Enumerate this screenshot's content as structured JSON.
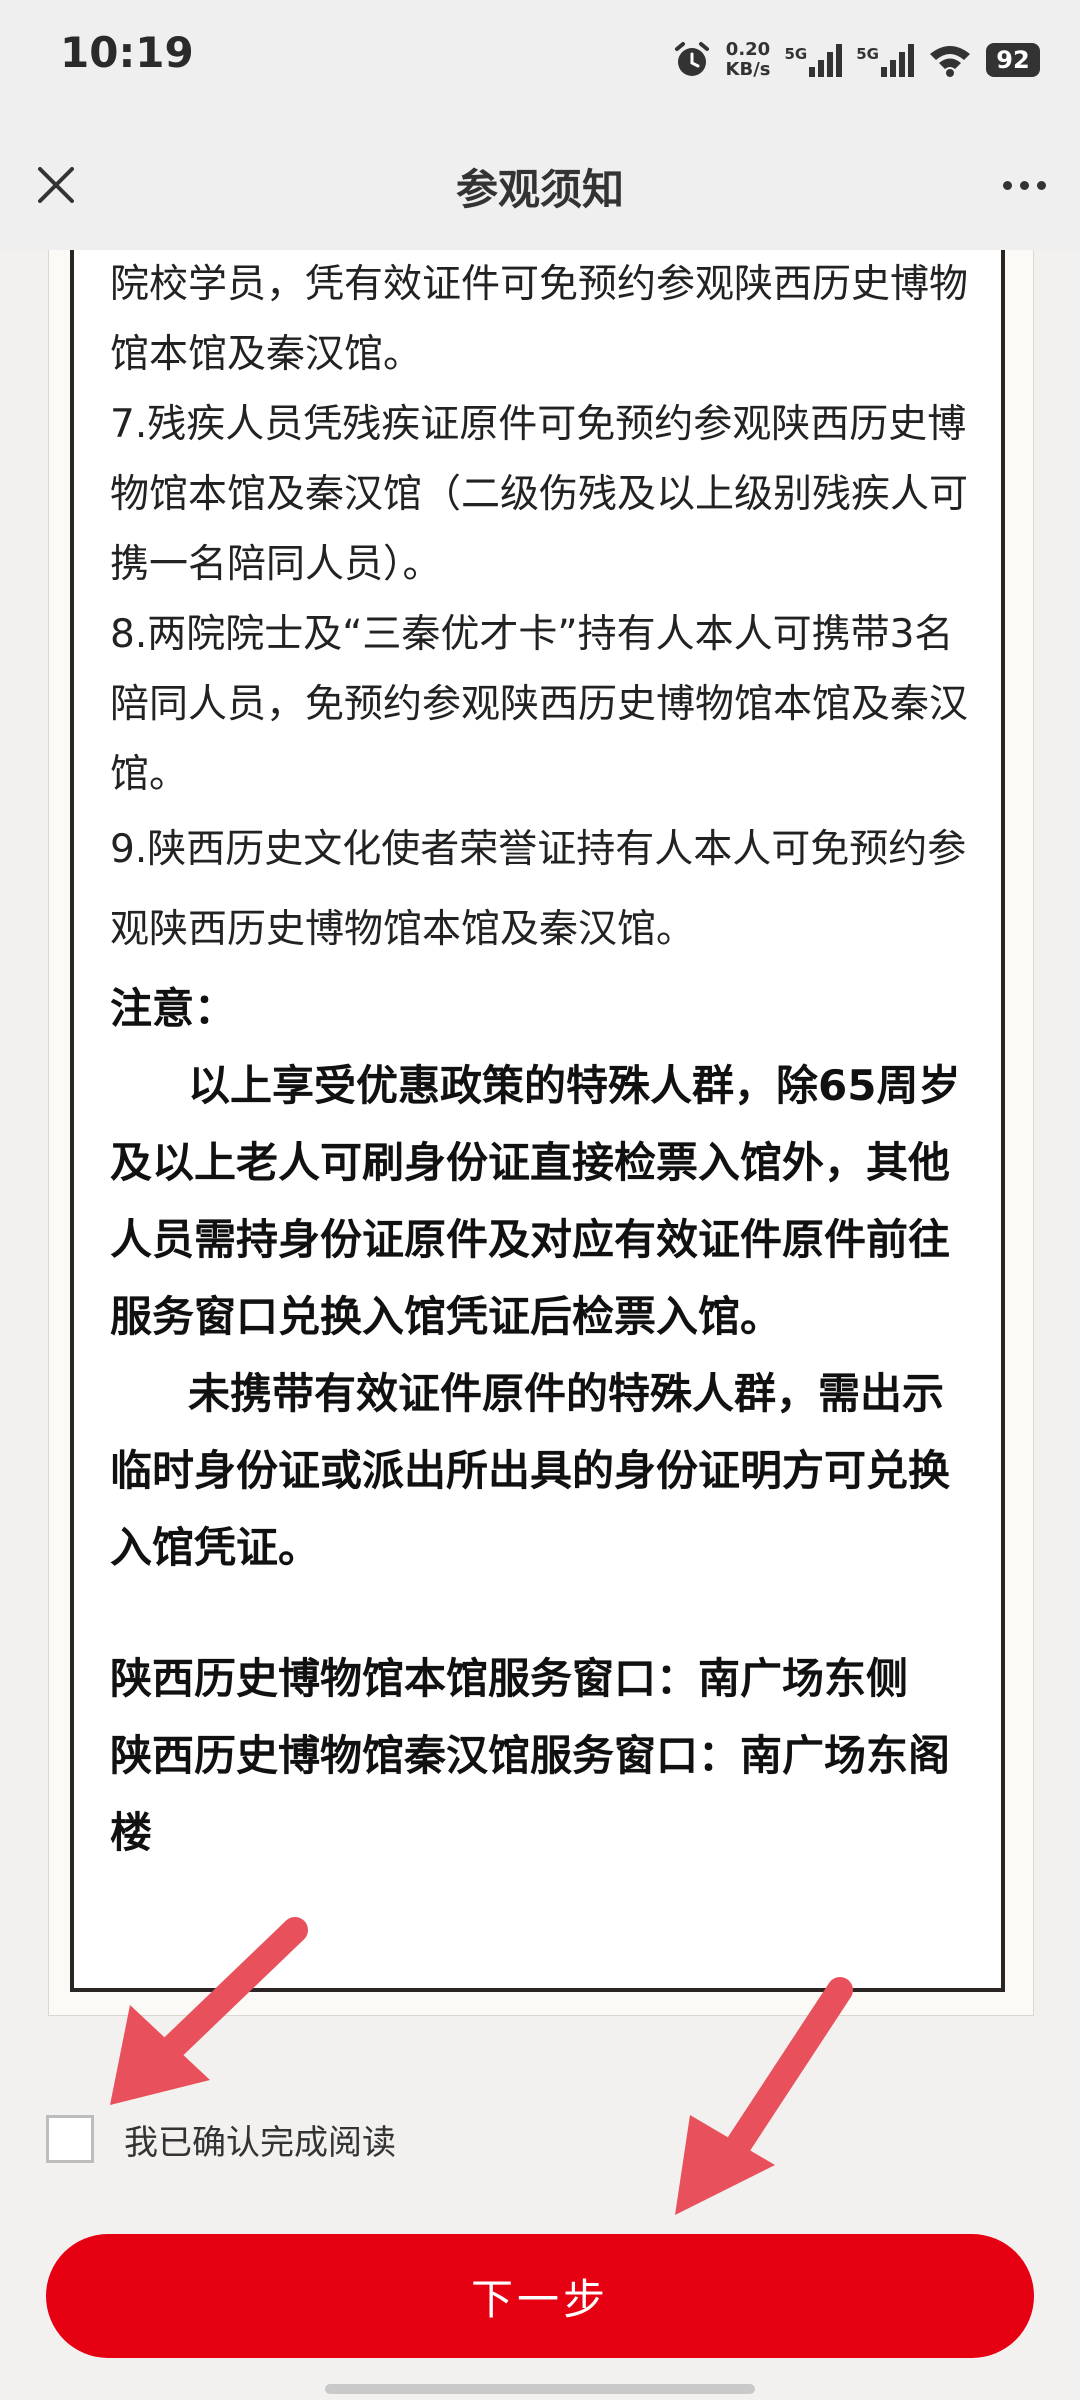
{
  "status_bar": {
    "time": "10:19",
    "net_speed_value": "0.20",
    "net_speed_unit": "KB/s",
    "sim1": "5G",
    "sim2": "5G",
    "battery": "92",
    "icons": [
      "alarm-icon",
      "signal-5g-icon",
      "signal-5g-icon",
      "wifi-icon",
      "battery-icon"
    ]
  },
  "nav": {
    "title": "参观须知",
    "close_icon": "close-icon",
    "more_icon": "more-icon"
  },
  "notice": {
    "paragraphs": [
      "院校学员，凭有效证件可免预约参观陕西历史博物馆本馆及秦汉馆。",
      "7.残疾人员凭残疾证原件可免预约参观陕西历史博物馆本馆及秦汉馆（二级伤残及以上级别残疾人可携一名陪同人员）。",
      "8.两院院士及“三秦优才卡”持有人本人可携带3名陪同人员，免预约参观陕西历史博物馆本馆及秦汉馆。",
      "9.陕西历史文化使者荣誉证持有人本人可免预约参观陕西历史博物馆本馆及秦汉馆。"
    ],
    "attention_title": "注意：",
    "attention_1": "以上享受优惠政策的特殊人群，除65周岁及以上老人可刷身份证直接检票入馆外，其他人员需持身份证原件及对应有效证件原件前往服务窗口兑换入馆凭证后检票入馆。",
    "attention_2": "未携带有效证件原件的特殊人群，需出示临时身份证或派出所出具的身份证明方可兑换入馆凭证。",
    "window_main": "陕西历史博物馆本馆服务窗口：南广场东侧",
    "window_qinhan": "陕西历史博物馆秦汉馆服务窗口：南广场东阁楼"
  },
  "confirm": {
    "label": "我已确认完成阅读",
    "checked": false
  },
  "next_button": {
    "label": "下一步"
  },
  "colors": {
    "primary": "#e50012",
    "annotation_arrow": "#e8505b",
    "background": "#f2f1ef"
  }
}
